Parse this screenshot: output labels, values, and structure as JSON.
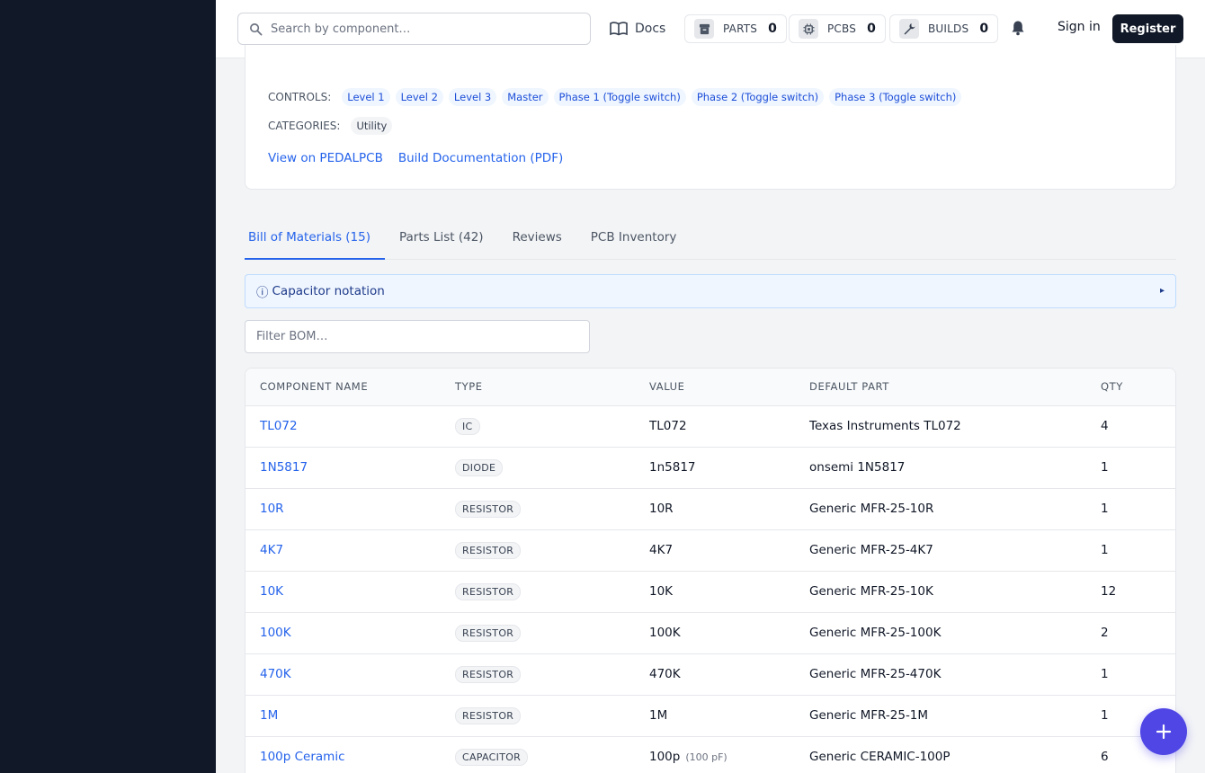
{
  "header": {
    "search_placeholder": "Search by component…",
    "docs_label": "Docs",
    "counters": [
      {
        "label": "PARTS",
        "count": "0"
      },
      {
        "label": "PCBS",
        "count": "0"
      },
      {
        "label": "BUILDS",
        "count": "0"
      }
    ],
    "signin_label": "Sign in",
    "register_label": "Register"
  },
  "project": {
    "controls_label": "CONTROLS:",
    "controls": [
      "Level 1",
      "Level 2",
      "Level 3",
      "Master",
      "Phase 1 (Toggle switch)",
      "Phase 2 (Toggle switch)",
      "Phase 3 (Toggle switch)"
    ],
    "categories_label": "CATEGORIES:",
    "categories": [
      "Utility"
    ],
    "links": [
      "View on PEDALPCB",
      "Build Documentation (PDF)"
    ]
  },
  "tabs": [
    "Bill of Materials (15)",
    "Parts List (42)",
    "Reviews",
    "PCB Inventory"
  ],
  "notice": {
    "icon": "ⓘ",
    "text": "Capacitor notation",
    "toggle": "▸"
  },
  "bom": {
    "filter_placeholder": "Filter BOM…",
    "columns": [
      "COMPONENT NAME",
      "TYPE",
      "VALUE",
      "DEFAULT PART",
      "QTY"
    ],
    "rows": [
      {
        "name": "TL072",
        "type": "IC",
        "value": "TL072",
        "note": "",
        "part": "Texas Instruments TL072",
        "qty": "4"
      },
      {
        "name": "1N5817",
        "type": "DIODE",
        "value": "1n5817",
        "note": "",
        "part": "onsemi 1N5817",
        "qty": "1"
      },
      {
        "name": "10R",
        "type": "RESISTOR",
        "value": "10R",
        "note": "",
        "part": "Generic MFR-25-10R",
        "qty": "1"
      },
      {
        "name": "4K7",
        "type": "RESISTOR",
        "value": "4K7",
        "note": "",
        "part": "Generic MFR-25-4K7",
        "qty": "1"
      },
      {
        "name": "10K",
        "type": "RESISTOR",
        "value": "10K",
        "note": "",
        "part": "Generic MFR-25-10K",
        "qty": "12"
      },
      {
        "name": "100K",
        "type": "RESISTOR",
        "value": "100K",
        "note": "",
        "part": "Generic MFR-25-100K",
        "qty": "2"
      },
      {
        "name": "470K",
        "type": "RESISTOR",
        "value": "470K",
        "note": "",
        "part": "Generic MFR-25-470K",
        "qty": "1"
      },
      {
        "name": "1M",
        "type": "RESISTOR",
        "value": "1M",
        "note": "",
        "part": "Generic MFR-25-1M",
        "qty": "1"
      },
      {
        "name": "100p Ceramic",
        "type": "CAPACITOR",
        "value": "100p",
        "note": "(100 pF)",
        "part": "Generic CERAMIC-100P",
        "qty": "6"
      }
    ]
  },
  "icons": {
    "search": "search-icon",
    "docs": "book-open-icon",
    "parts": "archive-box-icon",
    "pcbs": "chip-icon",
    "builds": "wrench-icon",
    "bell": "bell-icon",
    "fab": "plus-icon"
  },
  "colors": {
    "accent": "#2563eb",
    "sidebar": "#111827",
    "fab": "#4f46e5"
  }
}
